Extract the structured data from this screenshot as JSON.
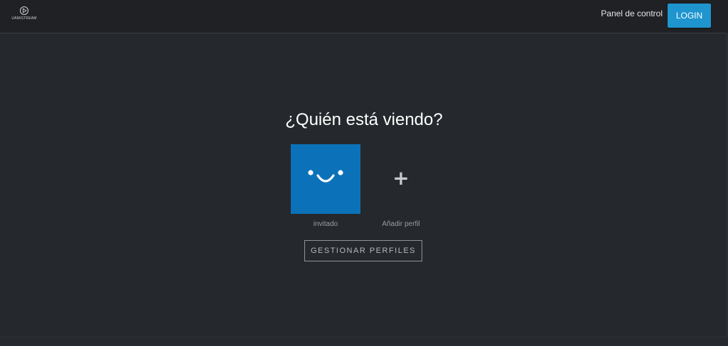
{
  "header": {
    "logo_text": "UAMISTREAM",
    "panel_link": "Panel de control",
    "login_label": "LOGIN"
  },
  "main": {
    "title": "¿Quién está viendo?",
    "profiles": [
      {
        "label": "invitado",
        "icon": "smiley-face-icon"
      },
      {
        "label": "Añadir perfil",
        "icon": "plus-icon",
        "glyph": "+"
      }
    ],
    "manage_label": "GESTIONAR PERFILES"
  },
  "colors": {
    "background": "#25282c",
    "header": "#1f2124",
    "accent": "#1e95cf",
    "avatar": "#0b72b9"
  }
}
